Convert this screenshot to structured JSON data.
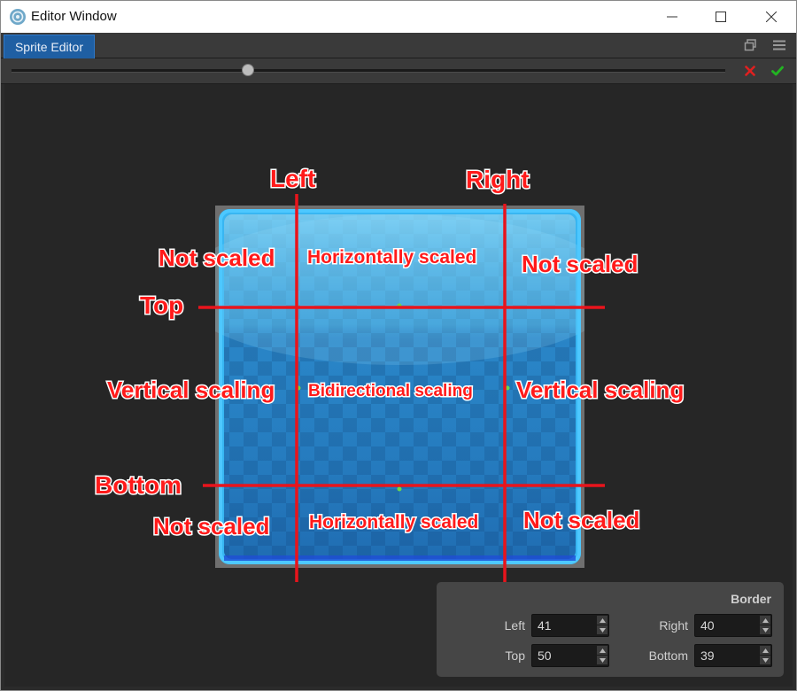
{
  "window": {
    "title": "Editor Window"
  },
  "tabs": [
    {
      "label": "Sprite Editor",
      "active": true
    }
  ],
  "toolbar": {
    "zoom_slider": 0.33,
    "revert_icon": "x-icon",
    "apply_icon": "check-icon"
  },
  "annotations": {
    "left": "Left",
    "right": "Right",
    "top": "Top",
    "bottom": "Bottom",
    "top_left": "Not scaled",
    "top_center": "Horizontally scaled",
    "top_right": "Not scaled",
    "mid_left": "Vertical scaling",
    "mid_center": "Bidirectional scaling",
    "mid_right": "Vertical scaling",
    "bottom_left": "Not scaled",
    "bottom_center": "Horizontally scaled",
    "bottom_right": "Not scaled"
  },
  "border_panel": {
    "title": "Border",
    "left_label": "Left",
    "left_value": "41",
    "right_label": "Right",
    "right_value": "40",
    "top_label": "Top",
    "top_value": "50",
    "bottom_label": "Bottom",
    "bottom_value": "39"
  },
  "colors": {
    "tab_active": "#1f5fa3",
    "annotation_red": "#ff1a1a",
    "revert_red": "#e02020",
    "apply_green": "#22b422",
    "sprite_blue": "#2fa8e8"
  }
}
